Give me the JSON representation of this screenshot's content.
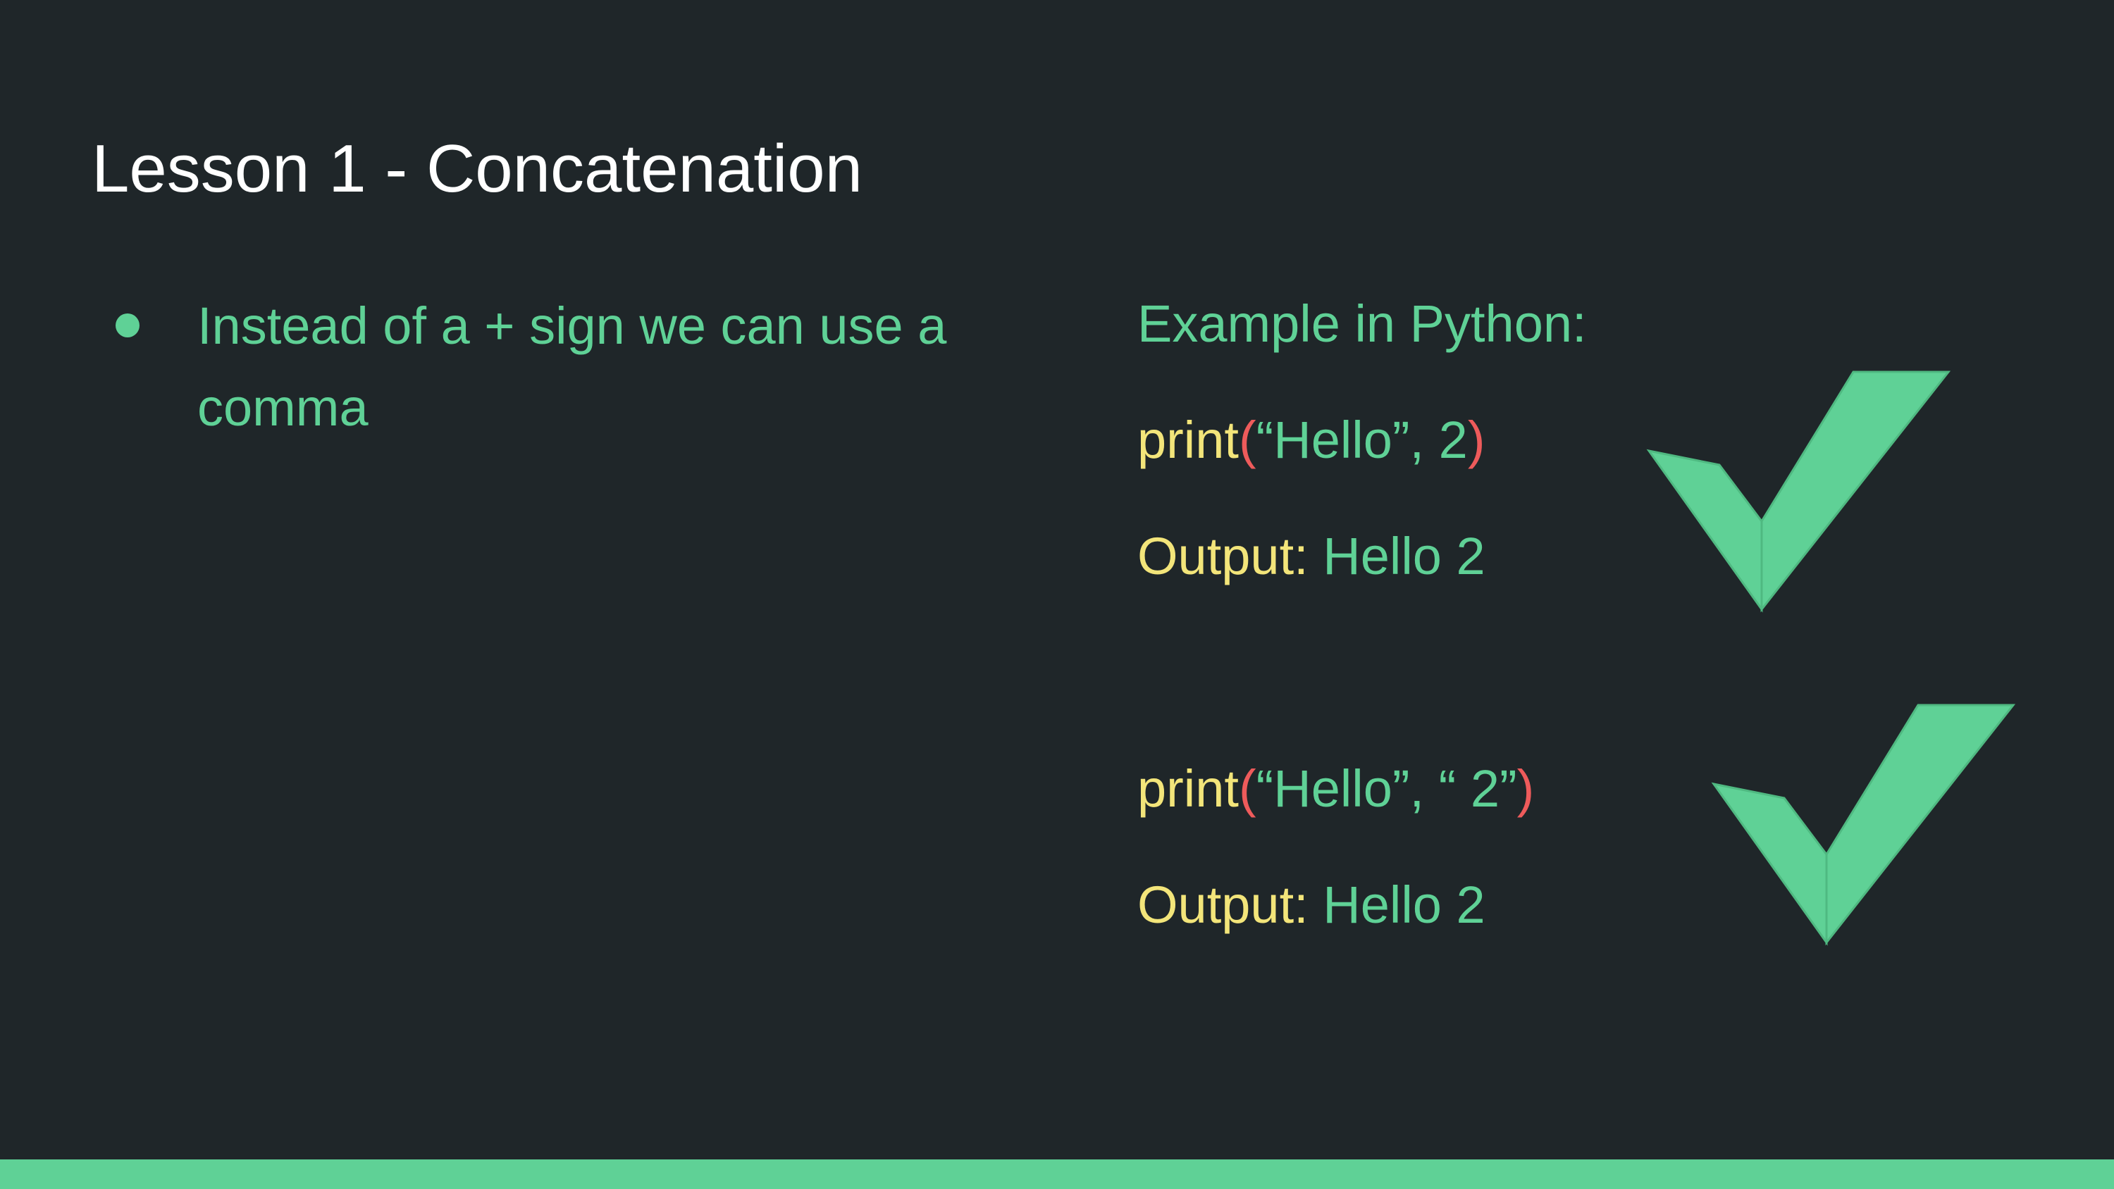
{
  "slide": {
    "title": "Lesson 1 - Concatenation",
    "bullet": "Instead of a + sign we can use a comma",
    "example_heading": "Example in Python:",
    "example1": {
      "func": "print",
      "open_paren": "(",
      "args": "“Hello”, 2",
      "close_paren": ")",
      "output_label": "Output:",
      "output_value": "Hello 2"
    },
    "example2": {
      "func": "print",
      "open_paren": "(",
      "args": "“Hello”, “ 2”",
      "close_paren": ")",
      "output_label": "Output:",
      "output_value": "Hello 2"
    },
    "check_icon": "checkmark-icon"
  },
  "colors": {
    "background": "#1f2629",
    "accent_green": "#5fd196",
    "keyword_yellow": "#f3e57a",
    "paren_red": "#ee5b5b",
    "title_white": "#ffffff"
  }
}
